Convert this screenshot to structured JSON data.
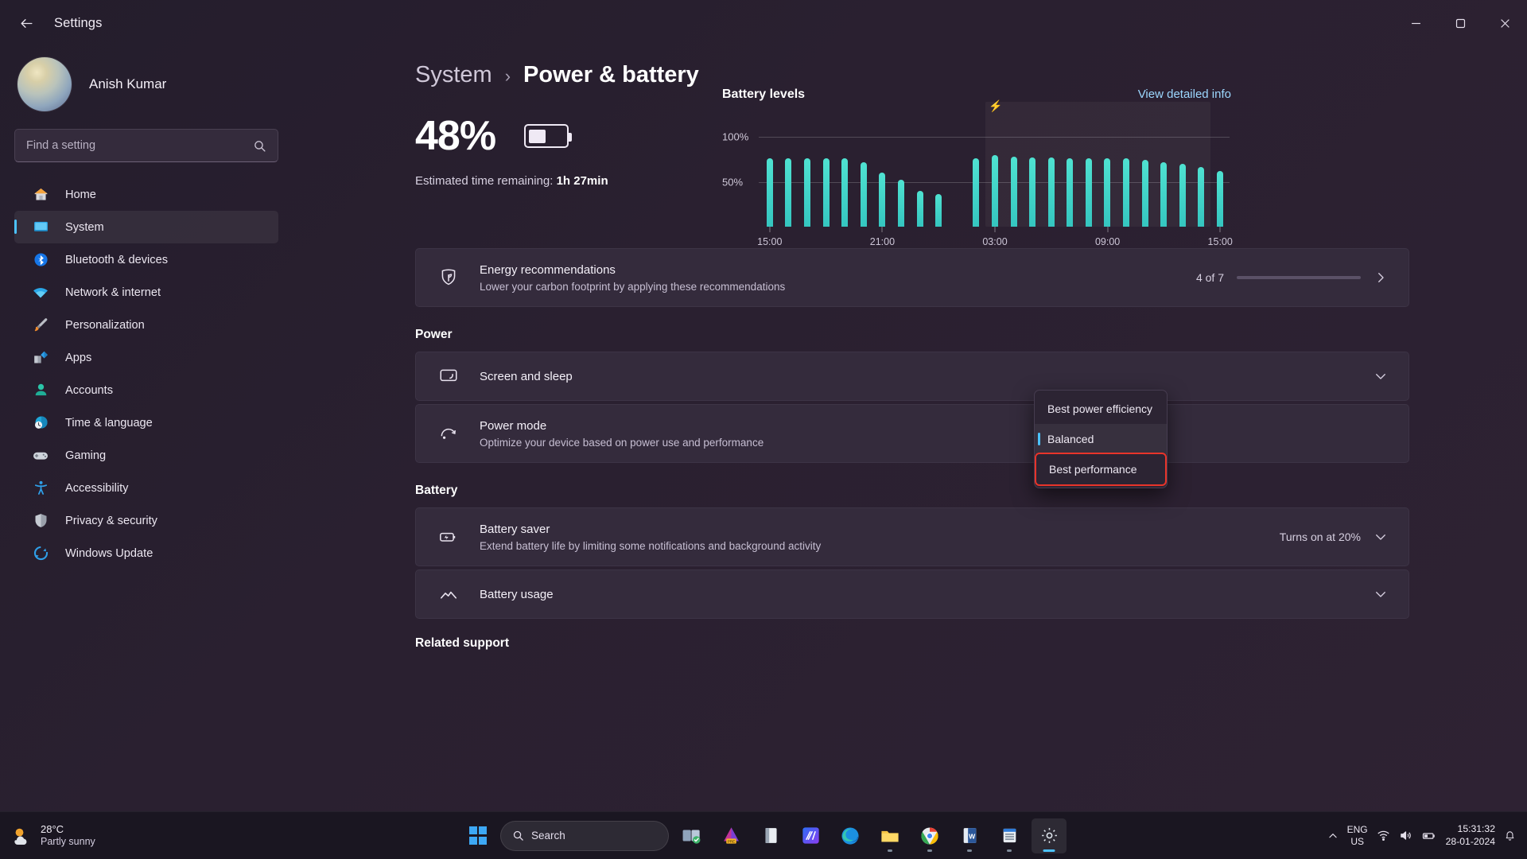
{
  "window": {
    "title": "Settings",
    "back_icon": "back-arrow-icon",
    "minimize_icon": "minimize-icon",
    "maximize_icon": "maximize-icon",
    "close_icon": "close-icon"
  },
  "sidebar": {
    "profile": {
      "name": "Anish Kumar",
      "avatar": "user-avatar"
    },
    "search": {
      "placeholder": "Find a setting",
      "value": "",
      "icon": "search-icon"
    },
    "items": [
      {
        "label": "Home",
        "icon": "home-icon",
        "active": false
      },
      {
        "label": "System",
        "icon": "system-icon",
        "active": true
      },
      {
        "label": "Bluetooth & devices",
        "icon": "bluetooth-icon",
        "active": false
      },
      {
        "label": "Network & internet",
        "icon": "network-icon",
        "active": false
      },
      {
        "label": "Personalization",
        "icon": "personalization-icon",
        "active": false
      },
      {
        "label": "Apps",
        "icon": "apps-icon",
        "active": false
      },
      {
        "label": "Accounts",
        "icon": "accounts-icon",
        "active": false
      },
      {
        "label": "Time & language",
        "icon": "time-language-icon",
        "active": false
      },
      {
        "label": "Gaming",
        "icon": "gaming-icon",
        "active": false
      },
      {
        "label": "Accessibility",
        "icon": "accessibility-icon",
        "active": false
      },
      {
        "label": "Privacy & security",
        "icon": "privacy-security-icon",
        "active": false
      },
      {
        "label": "Windows Update",
        "icon": "windows-update-icon",
        "active": false
      }
    ]
  },
  "main": {
    "breadcrumb": {
      "parent": "System",
      "separator": "›",
      "current": "Power & battery"
    },
    "battery": {
      "percent": "48%",
      "estimated_label": "Estimated time remaining:",
      "estimated_value": "1h 27min"
    },
    "energy_card": {
      "title": "Energy recommendations",
      "subtitle": "Lower your carbon footprint by applying these recommendations",
      "count": "4 of 7",
      "progress_percent": 57,
      "icon": "leaf-shield-icon",
      "chevron": "chevron-right-icon"
    },
    "power_section": {
      "heading": "Power"
    },
    "screen_sleep": {
      "title": "Screen and sleep",
      "icon": "screen-sleep-icon",
      "chevron": "chevron-down-icon"
    },
    "power_mode": {
      "title": "Power mode",
      "subtitle": "Optimize your device based on power use and performance",
      "icon": "power-mode-icon"
    },
    "battery_section": {
      "heading": "Battery"
    },
    "battery_saver": {
      "title": "Battery saver",
      "subtitle": "Extend battery life by limiting some notifications and background activity",
      "value": "Turns on at 20%",
      "icon": "battery-saver-icon",
      "chevron": "chevron-down-icon"
    },
    "battery_usage": {
      "title": "Battery usage",
      "icon": "battery-usage-icon",
      "chevron": "chevron-down-icon"
    },
    "related_support": "Related support"
  },
  "power_mode_flyout": {
    "options": [
      {
        "label": "Best power efficiency",
        "selected": false,
        "highlighted": false
      },
      {
        "label": "Balanced",
        "selected": true,
        "highlighted": false
      },
      {
        "label": "Best performance",
        "selected": false,
        "highlighted": true
      }
    ],
    "highlight_color": "#e8342a"
  },
  "chart_data": {
    "type": "bar",
    "title": "Battery levels",
    "link_label": "View detailed info",
    "xlabel": "",
    "ylabel": "",
    "ylim": [
      0,
      100
    ],
    "ytick_labels": [
      "100%",
      "50%"
    ],
    "ytick_values": [
      100,
      50
    ],
    "xtick_labels": [
      "15:00",
      "21:00",
      "03:00",
      "09:00",
      "15:00"
    ],
    "xtick_positions": [
      0,
      6,
      12,
      18,
      24
    ],
    "grid": true,
    "bar_color": "#35c6c0",
    "charging_band": {
      "start_index": 12,
      "end_index": 24,
      "icon": "charging-bolt-icon"
    },
    "values": [
      76,
      76,
      76,
      76,
      76,
      72,
      60,
      52,
      40,
      36,
      0,
      76,
      80,
      78,
      77,
      77,
      76,
      76,
      76,
      76,
      74,
      72,
      70,
      66,
      62
    ]
  },
  "taskbar": {
    "weather": {
      "temperature": "28°C",
      "condition": "Partly sunny",
      "icon": "partly-sunny-icon"
    },
    "start": {
      "icon": "windows-start-icon"
    },
    "search": {
      "placeholder": "Search",
      "icon": "search-icon"
    },
    "apps": [
      {
        "name": "task-view",
        "icon": "task-view-icon",
        "running": false,
        "active": false
      },
      {
        "name": "pre-app",
        "icon": "pre-app-icon",
        "running": false,
        "active": false
      },
      {
        "name": "notepad",
        "icon": "notepad-icon",
        "running": false,
        "active": false
      },
      {
        "name": "code-editor",
        "icon": "code-editor-icon",
        "running": false,
        "active": false
      },
      {
        "name": "edge",
        "icon": "edge-icon",
        "running": false,
        "active": false
      },
      {
        "name": "file-explorer",
        "icon": "file-explorer-icon",
        "running": true,
        "active": false
      },
      {
        "name": "chrome",
        "icon": "chrome-icon",
        "running": true,
        "active": false
      },
      {
        "name": "word",
        "icon": "word-icon",
        "running": true,
        "active": false
      },
      {
        "name": "calendar",
        "icon": "calendar-icon",
        "running": true,
        "active": false
      },
      {
        "name": "settings",
        "icon": "settings-gear-icon",
        "running": true,
        "active": true
      }
    ],
    "tray": {
      "chevron_up": "chevron-up-icon",
      "language_line1": "ENG",
      "language_line2": "US",
      "wifi_icon": "wifi-icon",
      "volume_icon": "volume-icon",
      "battery_icon": "battery-icon",
      "time": "15:31:32",
      "date": "28-01-2024",
      "notification_icon": "notification-bell-icon"
    }
  }
}
